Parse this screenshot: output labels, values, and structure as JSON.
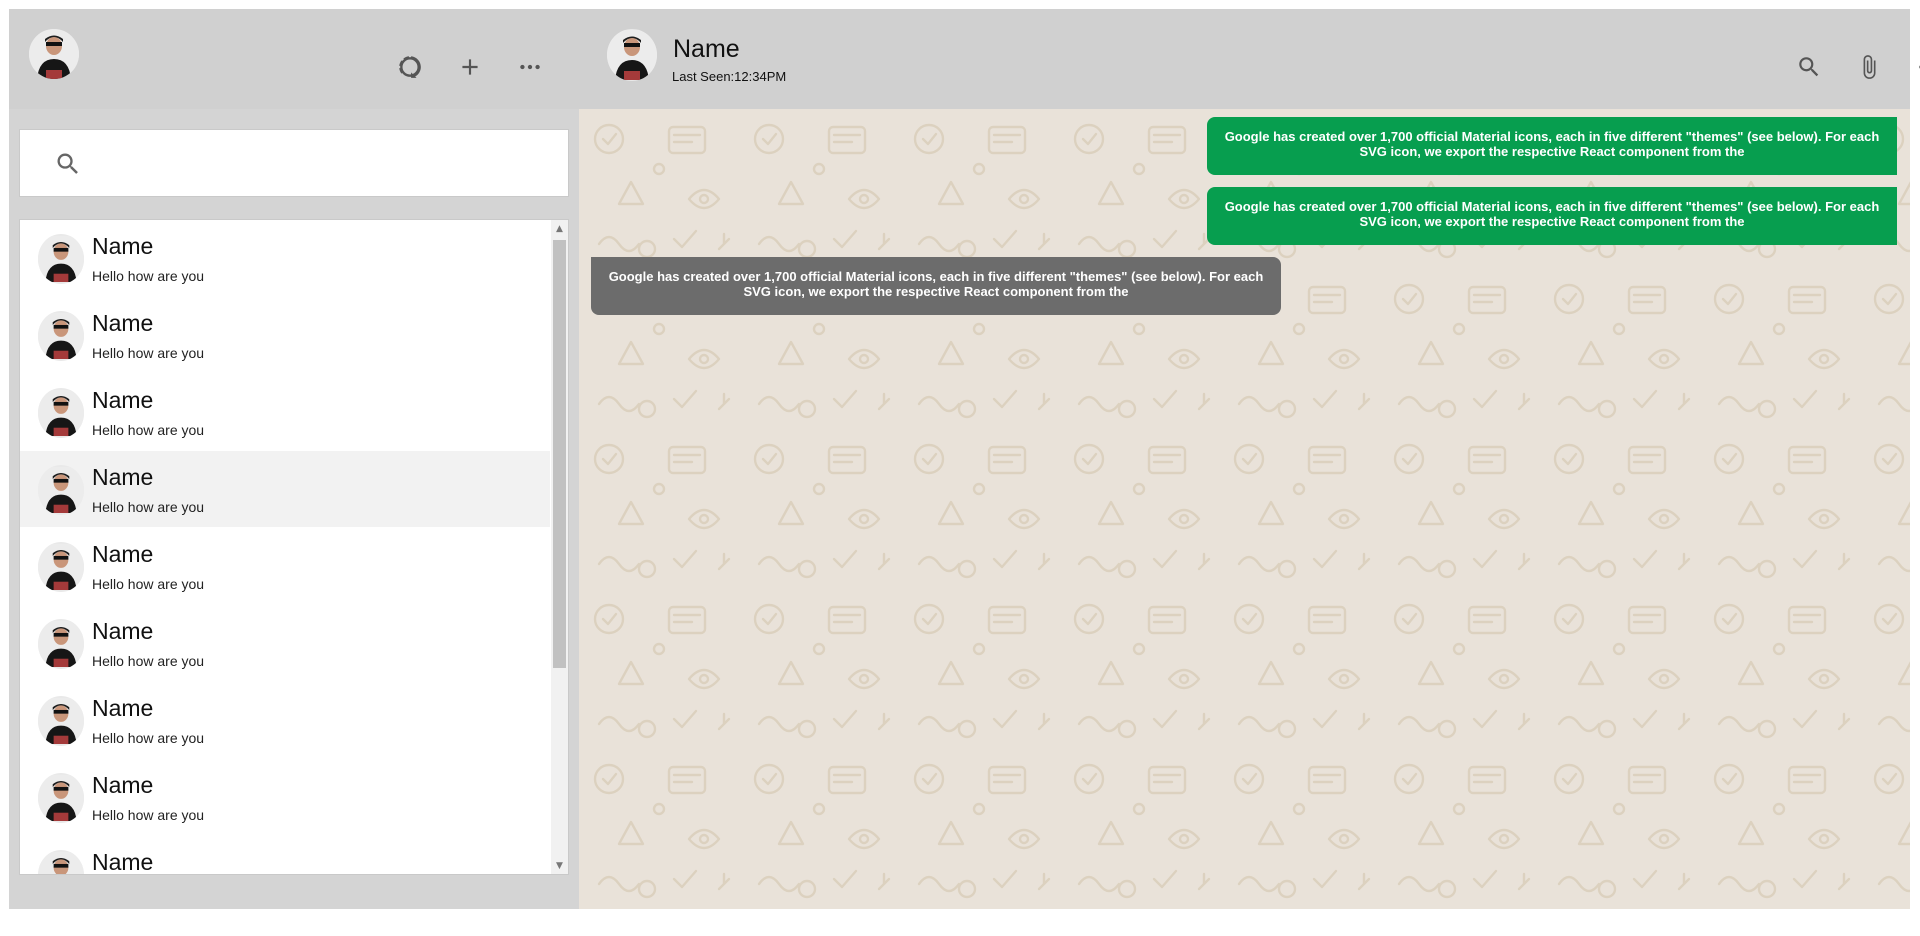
{
  "sidebar": {
    "header": {
      "status_icon": "status-ring-icon",
      "new_chat_icon": "plus-icon",
      "menu_icon": "more-horizontal-icon"
    },
    "search": {
      "placeholder": "",
      "value": "",
      "icon": "search-icon"
    },
    "chats": [
      {
        "name": "Name",
        "last_message": "Hello how are you",
        "active": false
      },
      {
        "name": "Name",
        "last_message": "Hello how are you",
        "active": false
      },
      {
        "name": "Name",
        "last_message": "Hello how are you",
        "active": false
      },
      {
        "name": "Name",
        "last_message": "Hello how are you",
        "active": true
      },
      {
        "name": "Name",
        "last_message": "Hello how are you",
        "active": false
      },
      {
        "name": "Name",
        "last_message": "Hello how are you",
        "active": false
      },
      {
        "name": "Name",
        "last_message": "Hello how are you",
        "active": false
      },
      {
        "name": "Name",
        "last_message": "Hello how are you",
        "active": false
      },
      {
        "name": "Name",
        "last_message": "",
        "active": false
      }
    ]
  },
  "chat": {
    "header": {
      "contact_name": "Name",
      "last_seen": "Last Seen:12:34PM",
      "search_icon": "search-icon",
      "attach_icon": "paperclip-icon",
      "menu_icon": "more-horizontal-icon"
    },
    "messages": [
      {
        "direction": "outgoing",
        "text": "Google has created over 1,700 official Material icons, each in five different \"themes\" (see below). For each SVG icon, we export the respective React component from the"
      },
      {
        "direction": "outgoing",
        "text": "Google has created over 1,700 official Material icons, each in five different \"themes\" (see below). For each SVG icon, we export the respective React component from the"
      },
      {
        "direction": "incoming",
        "text": "Google has created over 1,700 official Material icons, each in five different \"themes\" (see below). For each SVG icon, we export the respective React component from the"
      }
    ]
  },
  "colors": {
    "outgoing_bubble": "#079e4f",
    "incoming_bubble": "#6c6c6c",
    "header_bg": "#d0d0d0",
    "chat_bg": "#e9e2d9"
  }
}
